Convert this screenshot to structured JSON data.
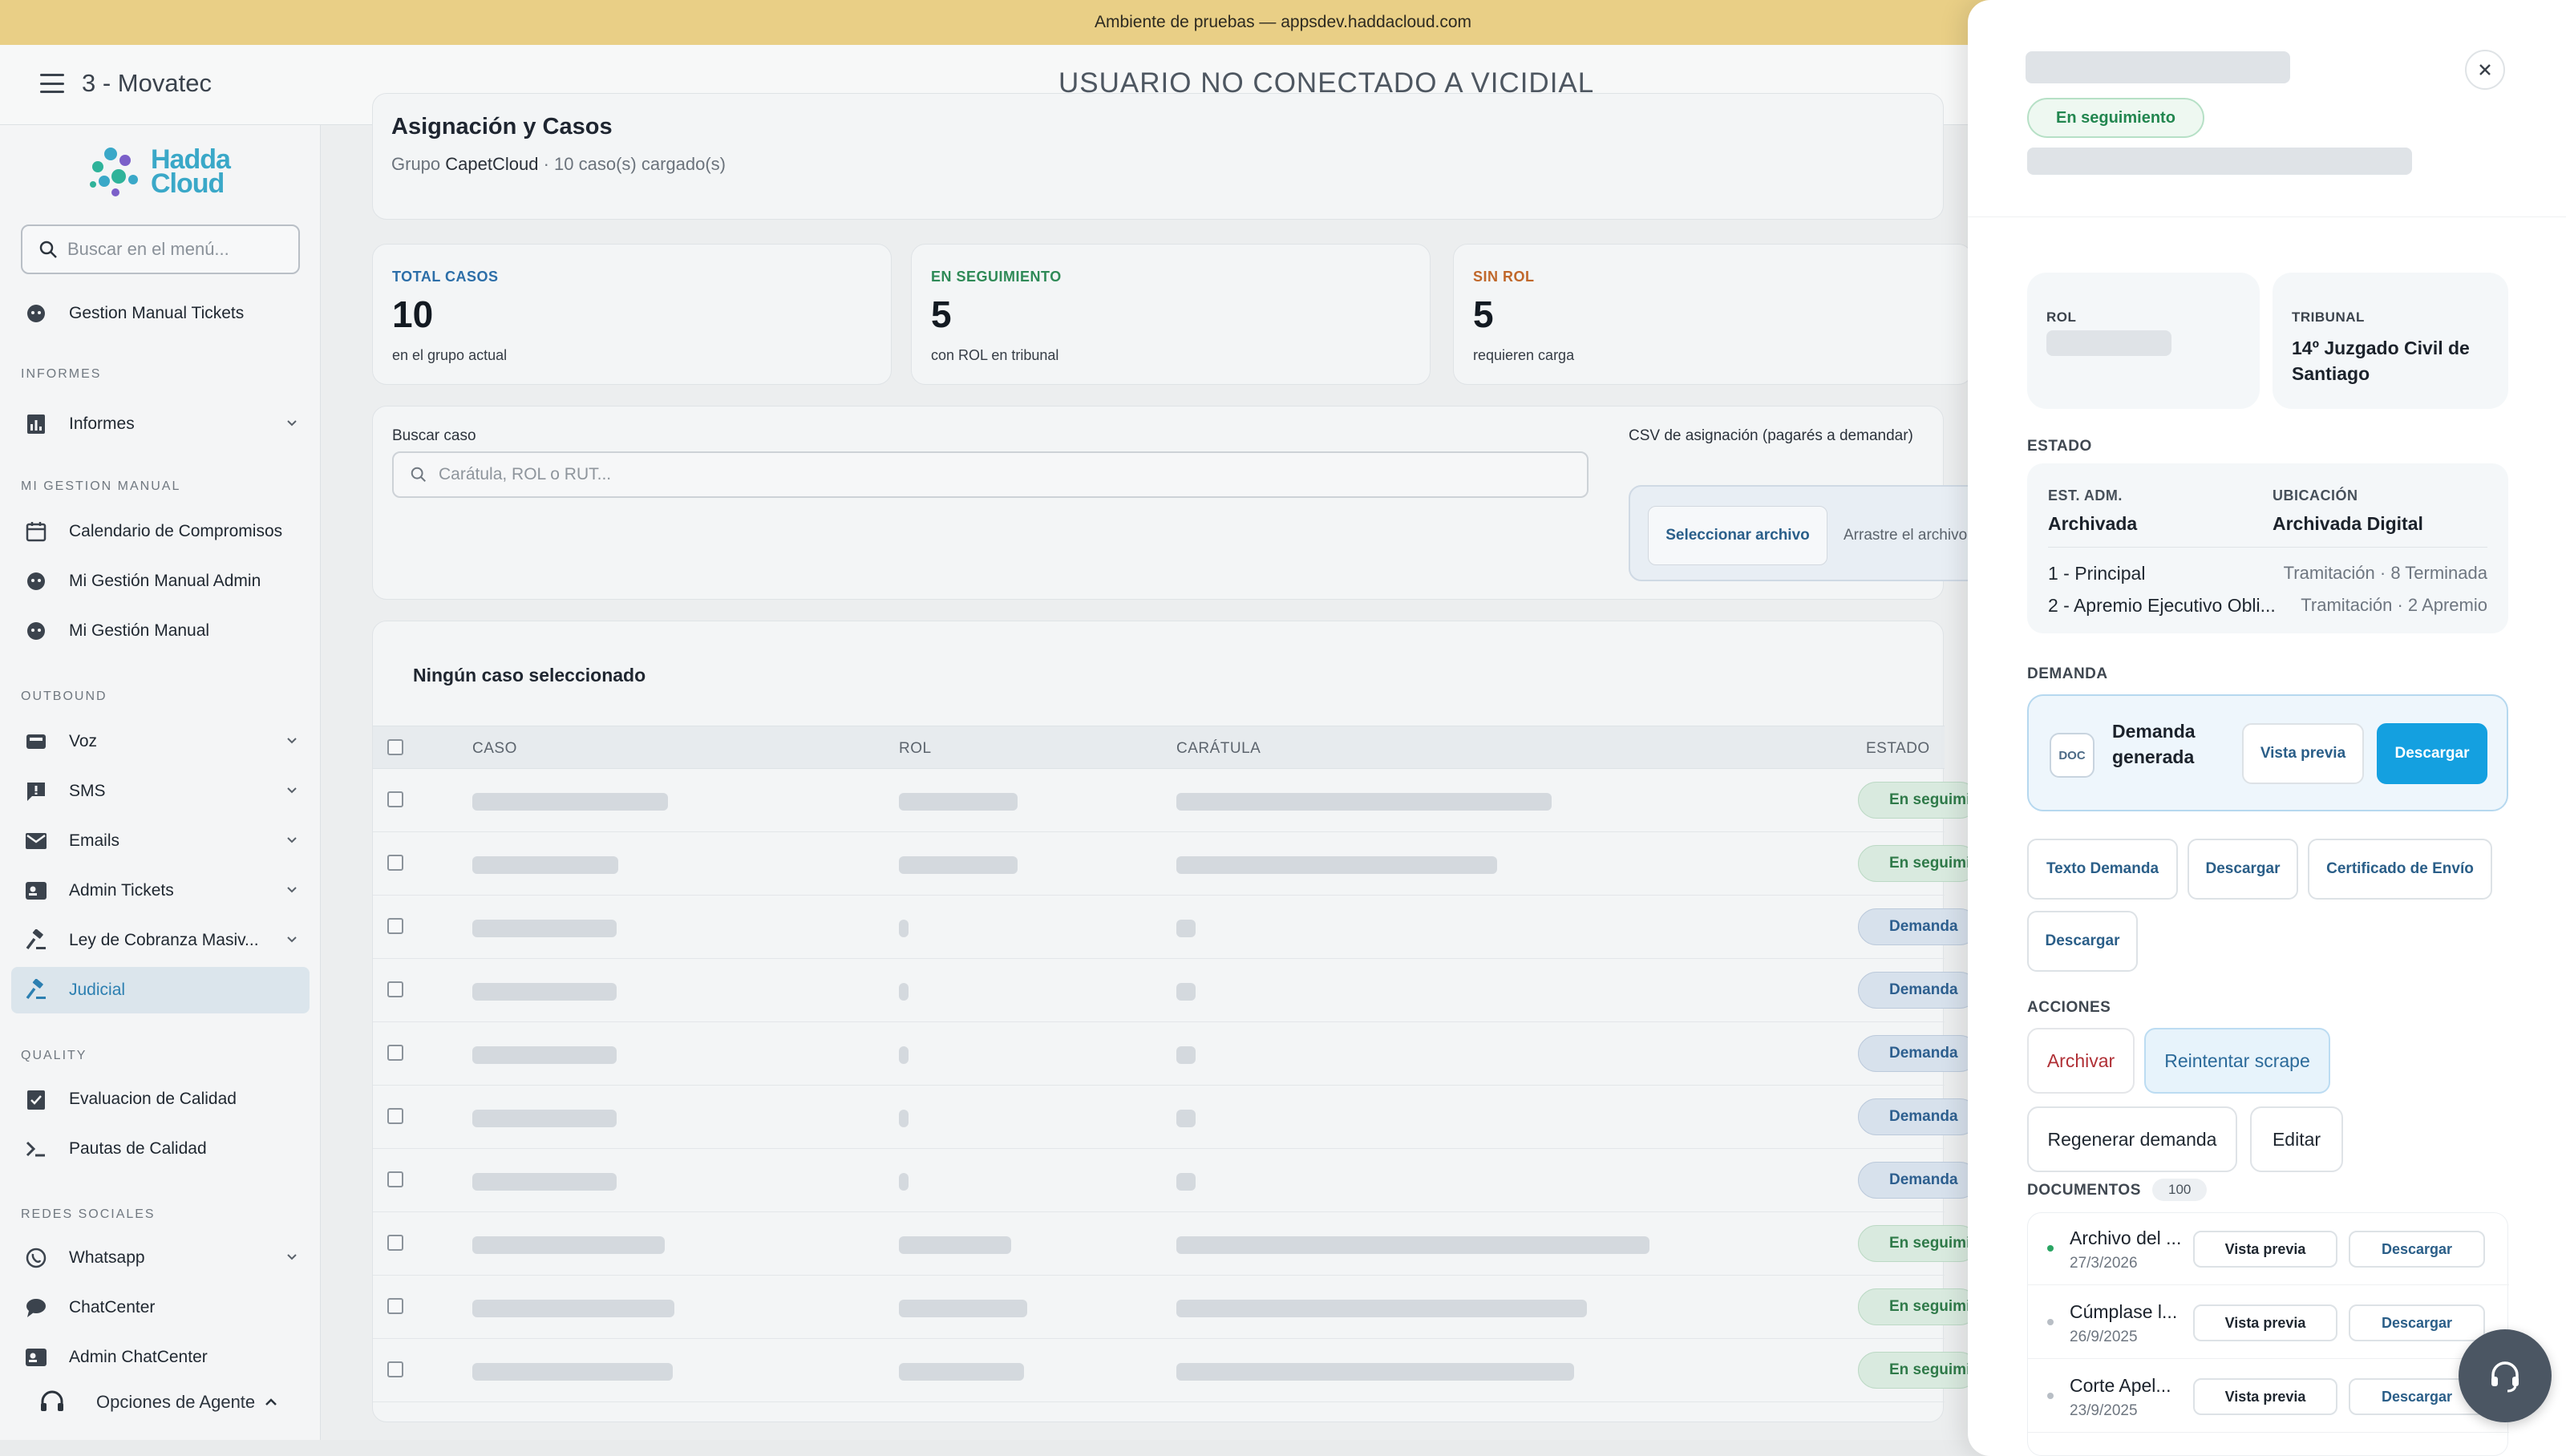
{
  "env_banner": "Ambiente de pruebas — appsdev.haddacloud.com",
  "topbar": {
    "app_title": "3 - Movatec",
    "connection_status": "USUARIO NO CONECTADO A VICIDIAL"
  },
  "sidebar": {
    "logo_text_1": "Hadda",
    "logo_text_2": "Cloud",
    "search_placeholder": "Buscar en el menú...",
    "top_item": "Gestion Manual Tickets",
    "sections": {
      "informes": "INFORMES",
      "gestion": "MI GESTION MANUAL",
      "outbound": "OUTBOUND",
      "quality": "QUALITY",
      "redes": "REDES SOCIALES"
    },
    "items": {
      "informes": "Informes",
      "calendario": "Calendario de Compromisos",
      "gestion_admin": "Mi Gestión Manual Admin",
      "gestion": "Mi Gestión Manual",
      "voz": "Voz",
      "sms": "SMS",
      "emails": "Emails",
      "admin_tickets": "Admin Tickets",
      "ley": "Ley de Cobranza Masiv...",
      "judicial": "Judicial",
      "evaluacion": "Evaluacion de Calidad",
      "pautas": "Pautas de Calidad",
      "whatsapp": "Whatsapp",
      "chatcenter": "ChatCenter",
      "admin_chatcenter": "Admin ChatCenter"
    },
    "agent_options": "Opciones de Agente"
  },
  "main": {
    "title": "Asignación y Casos",
    "subtitle_prefix": "Grupo",
    "group_name": "CapetCloud",
    "subtitle_suffix": "· 10 caso(s) cargado(s)",
    "stats": [
      {
        "label": "TOTAL CASOS",
        "value": "10",
        "note": "en el grupo actual",
        "color": "#2c6ea8"
      },
      {
        "label": "EN SEGUIMIENTO",
        "value": "5",
        "note": "con ROL en tribunal",
        "color": "#2f8a57"
      },
      {
        "label": "SIN ROL",
        "value": "5",
        "note": "requieren carga",
        "color": "#c0672a"
      }
    ],
    "search_label": "Buscar caso",
    "search_placeholder": "Carátula, ROL o RUT...",
    "csv_label": "CSV de asignación (pagarés a demandar)",
    "upload_button": "Seleccionar archivo",
    "upload_hint": "Arrastre el archivo",
    "no_selection": "Ningún caso seleccionado",
    "table": {
      "headers": [
        "CASO",
        "ROL",
        "CARÁTULA",
        "ESTADO"
      ],
      "rows": [
        {
          "status": "En seguimiento",
          "kind": "seg",
          "has_rol": true
        },
        {
          "status": "En seguimiento",
          "kind": "seg",
          "has_rol": true
        },
        {
          "status": "Demanda",
          "kind": "dem",
          "has_rol": false
        },
        {
          "status": "Demanda",
          "kind": "dem",
          "has_rol": false
        },
        {
          "status": "Demanda",
          "kind": "dem",
          "has_rol": false
        },
        {
          "status": "Demanda",
          "kind": "dem",
          "has_rol": false
        },
        {
          "status": "Demanda",
          "kind": "dem",
          "has_rol": false
        },
        {
          "status": "En seguimiento",
          "kind": "seg",
          "has_rol": true
        },
        {
          "status": "En seguimiento",
          "kind": "seg",
          "has_rol": true
        },
        {
          "status": "En seguimiento",
          "kind": "seg",
          "has_rol": true
        }
      ]
    }
  },
  "drawer": {
    "status": "En seguimiento",
    "rol_label": "ROL",
    "tribunal_label": "TRIBUNAL",
    "tribunal_value": "14º Juzgado Civil de Santiago",
    "estado_section": "ESTADO",
    "est_adm_label": "EST. ADM.",
    "est_adm_value": "Archivada",
    "ubicacion_label": "UBICACIÓN",
    "ubicacion_value": "Archivada Digital",
    "cuadernos": [
      {
        "name": "1 - Principal",
        "stage": "Tramitación · 8 Terminada"
      },
      {
        "name": "2 - Apremio Ejecutivo Obli...",
        "stage": "Tramitación · 2 Apremio"
      }
    ],
    "demanda_section": "DEMANDA",
    "doc_badge": "DOC",
    "demanda_title": "Demanda generada",
    "vista_previa": "Vista previa",
    "descargar": "Descargar",
    "texto_demanda": "Texto Demanda",
    "certificado": "Certificado de Envío",
    "acciones_section": "ACCIONES",
    "archivar": "Archivar",
    "reintentar": "Reintentar scrape",
    "regenerar": "Regenerar demanda",
    "editar": "Editar",
    "documentos_section": "DOCUMENTOS",
    "documentos_count": "100",
    "documents": [
      {
        "name": "Archivo del ...",
        "date": "27/3/2026",
        "dot": "#2aa563"
      },
      {
        "name": "Cúmplase l...",
        "date": "26/9/2025",
        "dot": "#b8bec5"
      },
      {
        "name": "Corte Apel...",
        "date": "23/9/2025",
        "dot": "#b8bec5"
      }
    ]
  }
}
